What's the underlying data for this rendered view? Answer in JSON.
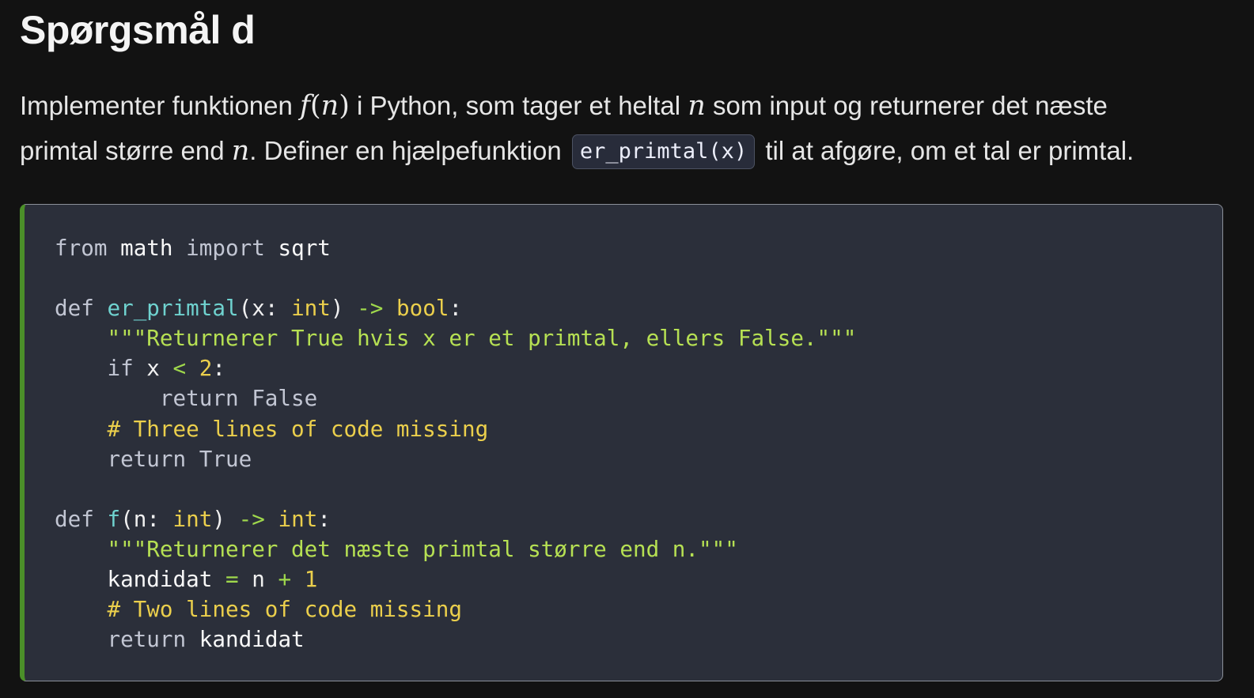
{
  "heading": "Spørgsmål d",
  "paragraph": {
    "line1": {
      "t1": "Implementer funktionen ",
      "math_f": "f",
      "math_open": "(",
      "math_n": "n",
      "math_close": ")",
      "t2": " i Python, som tager et heltal ",
      "math_n2": "n",
      "t3": " som input og returnerer det næste"
    },
    "line2": {
      "t1": "primtal større end ",
      "math_n": "n",
      "t2": ". Definer en hjælpefunktion ",
      "code": "er_primtal(x)",
      "t3": " til at afgøre, om et tal er primtal."
    }
  },
  "code_lines": [
    [
      [
        "kw",
        "from"
      ],
      [
        "pl",
        " "
      ],
      [
        "id",
        "math"
      ],
      [
        "pl",
        " "
      ],
      [
        "kw",
        "import"
      ],
      [
        "pl",
        " "
      ],
      [
        "id",
        "sqrt"
      ]
    ],
    [],
    [
      [
        "kw",
        "def"
      ],
      [
        "pl",
        " "
      ],
      [
        "fn",
        "er_primtal"
      ],
      [
        "pl",
        "(x: "
      ],
      [
        "ty",
        "int"
      ],
      [
        "pl",
        ") "
      ],
      [
        "op",
        "->"
      ],
      [
        "pl",
        " "
      ],
      [
        "ty",
        "bool"
      ],
      [
        "pl",
        ":"
      ]
    ],
    [
      [
        "pl",
        "    "
      ],
      [
        "str",
        "\"\"\"Returnerer True hvis x er et primtal, ellers False.\"\"\""
      ]
    ],
    [
      [
        "pl",
        "    "
      ],
      [
        "kw",
        "if"
      ],
      [
        "pl",
        " x "
      ],
      [
        "op",
        "<"
      ],
      [
        "pl",
        " "
      ],
      [
        "num",
        "2"
      ],
      [
        "pl",
        ":"
      ]
    ],
    [
      [
        "pl",
        "        "
      ],
      [
        "kw",
        "return False"
      ]
    ],
    [
      [
        "pl",
        "    "
      ],
      [
        "cmt",
        "# Three lines of code missing"
      ]
    ],
    [
      [
        "pl",
        "    "
      ],
      [
        "kw",
        "return True"
      ]
    ],
    [],
    [
      [
        "kw",
        "def"
      ],
      [
        "pl",
        " "
      ],
      [
        "fn",
        "f"
      ],
      [
        "pl",
        "(n: "
      ],
      [
        "ty",
        "int"
      ],
      [
        "pl",
        ") "
      ],
      [
        "op",
        "->"
      ],
      [
        "pl",
        " "
      ],
      [
        "ty",
        "int"
      ],
      [
        "pl",
        ":"
      ]
    ],
    [
      [
        "pl",
        "    "
      ],
      [
        "str",
        "\"\"\"Returnerer det næste primtal større end n.\"\"\""
      ]
    ],
    [
      [
        "pl",
        "    "
      ],
      [
        "id",
        "kandidat"
      ],
      [
        "pl",
        " "
      ],
      [
        "op",
        "="
      ],
      [
        "pl",
        " n "
      ],
      [
        "op",
        "+"
      ],
      [
        "pl",
        " "
      ],
      [
        "num",
        "1"
      ]
    ],
    [
      [
        "pl",
        "    "
      ],
      [
        "cmt",
        "# Two lines of code missing"
      ]
    ],
    [
      [
        "pl",
        "    "
      ],
      [
        "kw",
        "return"
      ],
      [
        "pl",
        " "
      ],
      [
        "id",
        "kandidat"
      ]
    ]
  ]
}
